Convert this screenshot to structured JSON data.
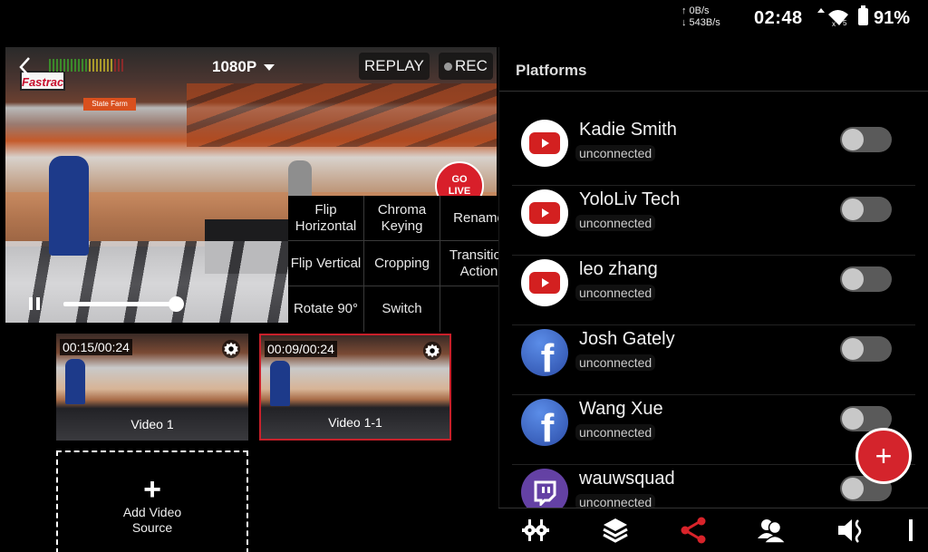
{
  "status_bar": {
    "upload_speed": "0B/s",
    "download_speed": "543B/s",
    "time": "02:48",
    "battery_percent": "91%"
  },
  "preview": {
    "resolution": "1080P",
    "replay_label": "REPLAY",
    "rec_label": "REC",
    "go_live_line1": "GO",
    "go_live_line2": "LIVE",
    "sign_text": "Fastrac",
    "sign2_text": "State Farm",
    "playback_progress": 0.9
  },
  "context_menu": {
    "items": [
      {
        "label": "Flip Horizontal"
      },
      {
        "label": "Chroma Keying"
      },
      {
        "label": "Rename"
      },
      {
        "label": "Flip Vertical"
      },
      {
        "label": "Cropping"
      },
      {
        "label": "Transition Action"
      },
      {
        "label": "Rotate 90°"
      },
      {
        "label": "Switch"
      },
      {
        "label": ""
      }
    ]
  },
  "sources": [
    {
      "time": "00:15/00:24",
      "label": "Video 1",
      "selected": false
    },
    {
      "time": "00:09/00:24",
      "label": "Video 1-1",
      "selected": true
    }
  ],
  "add_source": {
    "plus": "+",
    "label_line1": "Add Video",
    "label_line2": "Source"
  },
  "platforms": {
    "title": "Platforms",
    "items": [
      {
        "name": "Kadie Smith",
        "status": "unconnected",
        "service": "youtube",
        "enabled": false
      },
      {
        "name": "YoloLiv Tech",
        "status": "unconnected",
        "service": "youtube",
        "enabled": false
      },
      {
        "name": "leo zhang",
        "status": "unconnected",
        "service": "youtube",
        "enabled": false
      },
      {
        "name": "Josh Gately",
        "status": "unconnected",
        "service": "facebook",
        "enabled": false
      },
      {
        "name": "Wang Xue",
        "status": "unconnected",
        "service": "facebook",
        "enabled": false
      },
      {
        "name": "wauwsquad",
        "status": "unconnected",
        "service": "twitch",
        "enabled": false
      }
    ],
    "fab_label": "+"
  },
  "bottom_nav": {
    "items": [
      {
        "icon": "mixer-icon",
        "active": false
      },
      {
        "icon": "layers-icon",
        "active": false
      },
      {
        "icon": "share-icon",
        "active": true
      },
      {
        "icon": "users-icon",
        "active": false
      },
      {
        "icon": "audio-icon",
        "active": false
      }
    ],
    "active_color": "#d8232a"
  },
  "colors": {
    "accent": "#d8232a",
    "youtube": "#d32020",
    "facebook": "#3b5ec6",
    "twitch": "#6441a4"
  }
}
